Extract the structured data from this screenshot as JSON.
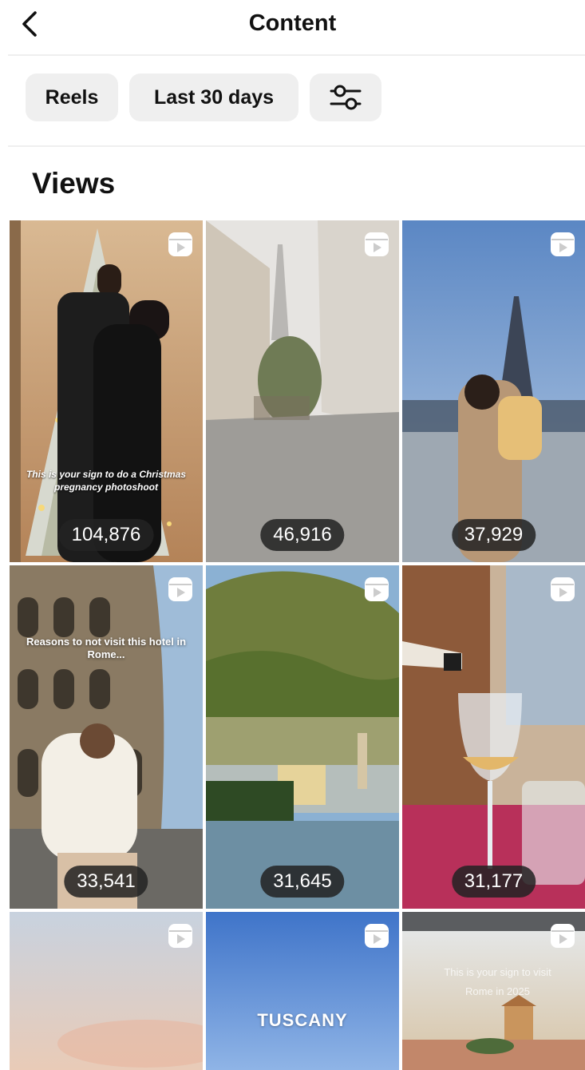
{
  "header": {
    "title": "Content",
    "back_icon": "chevron-left-icon"
  },
  "filters": {
    "reels_label": "Reels",
    "range_label": "Last 30 days",
    "filter_icon": "sliders-icon"
  },
  "section": {
    "title": "Views"
  },
  "reels": [
    {
      "views": "104,876",
      "caption": "This is your sign to do a Christmas pregnancy photoshoot"
    },
    {
      "views": "46,916",
      "caption": ""
    },
    {
      "views": "37,929",
      "caption": ""
    },
    {
      "views": "33,541",
      "caption": "Reasons to not visit this hotel in Rome..."
    },
    {
      "views": "31,645",
      "caption": ""
    },
    {
      "views": "31,177",
      "caption": ""
    },
    {
      "views": "",
      "caption": ""
    },
    {
      "views": "",
      "caption": "TUSCANY"
    },
    {
      "views": "",
      "caption": "This is your sign to visit Rome in 2025"
    }
  ],
  "colors": {
    "chip_bg": "#efefef",
    "badge_bg": "#232323",
    "text": "#111111"
  }
}
